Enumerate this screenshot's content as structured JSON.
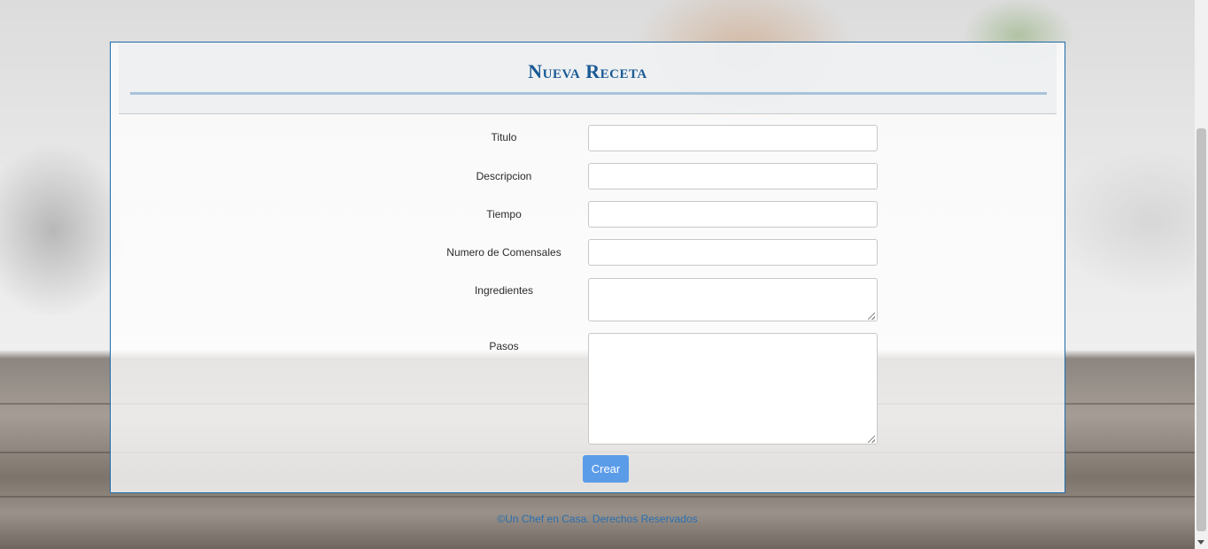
{
  "form": {
    "title": "Nueva Receta",
    "fields": [
      {
        "label": "Titulo",
        "value": ""
      },
      {
        "label": "Descripcion",
        "value": ""
      },
      {
        "label": "Tiempo",
        "value": ""
      },
      {
        "label": "Numero de Comensales",
        "value": ""
      },
      {
        "label": "Ingredientes",
        "value": ""
      },
      {
        "label": "Pasos",
        "value": ""
      }
    ],
    "submit_label": "Crear"
  },
  "footer": {
    "text": "©Un Chef en Casa. Derechos Reservados"
  },
  "colors": {
    "title": "#1a5a94",
    "panel_border": "#1e6aa8",
    "button": "#5b9ce8",
    "footer_link": "#2a6fb0"
  }
}
